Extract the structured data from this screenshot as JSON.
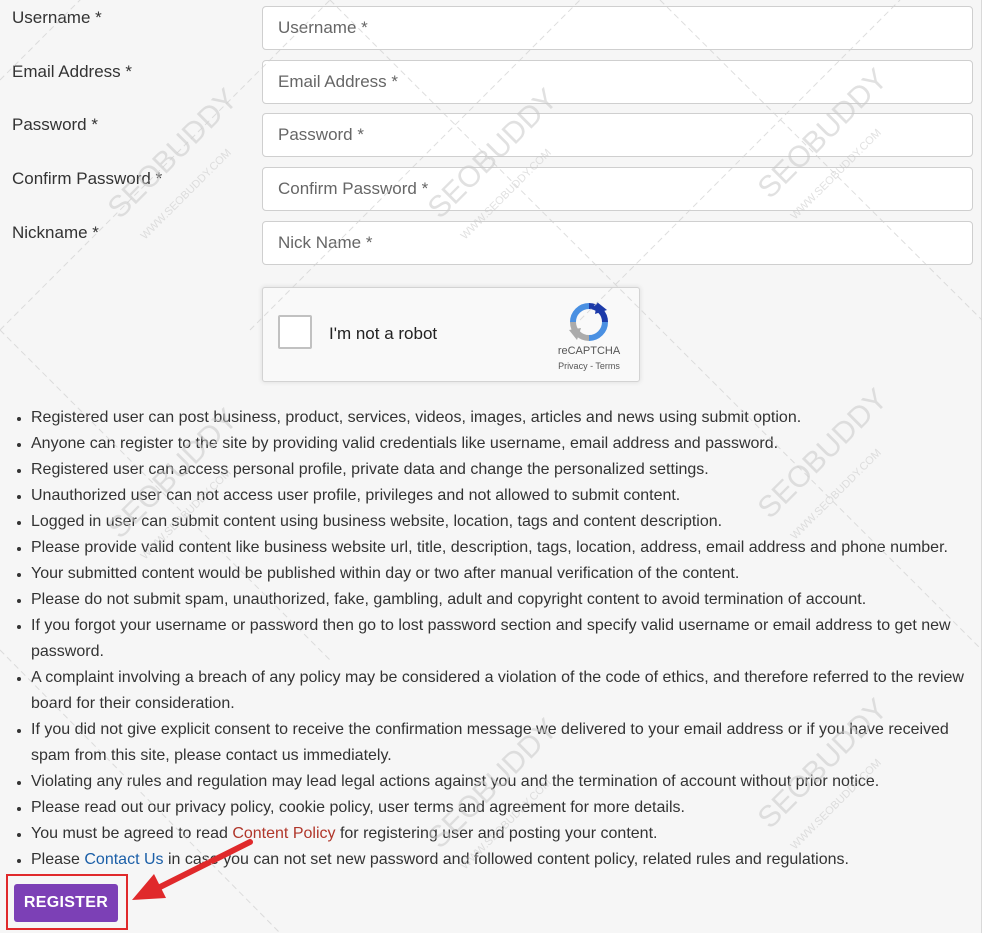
{
  "form": {
    "fields": [
      {
        "label": "Username *",
        "placeholder": "Username *"
      },
      {
        "label": "Email Address *",
        "placeholder": "Email Address *"
      },
      {
        "label": "Password *",
        "placeholder": "Password *"
      },
      {
        "label": "Confirm Password *",
        "placeholder": "Confirm Password *"
      },
      {
        "label": "Nickname *",
        "placeholder": "Nick Name *"
      }
    ]
  },
  "captcha": {
    "label": "I'm not a robot",
    "brand": "reCAPTCHA",
    "privacy": "Privacy",
    "separator": " - ",
    "terms": "Terms",
    "icon": "recaptcha-logo"
  },
  "rules": {
    "items": [
      "Registered user can post business, product, services, videos, images, articles and news using submit option.",
      "Anyone can register to the site by providing valid credentials like username, email address and password.",
      "Registered user can access personal profile, private data and change the personalized settings.",
      "Unauthorized user can not access user profile, privileges and not allowed to submit content.",
      "Logged in user can submit content using business website, location, tags and content description.",
      "Please provide valid content like business website url, title, description, tags, location, address, email address and phone number.",
      "Your submitted content would be published within day or two after manual verification of the content.",
      "Please do not submit spam, unauthorized, fake, gambling, adult and copyright content to avoid termination of account.",
      "If you forgot your username or password then go to lost password section and specify valid username or email address to get new password.",
      "A complaint involving a breach of any policy may be considered a violation of the code of ethics, and therefore referred to the review board for their consideration.",
      "If you did not give explicit consent to receive the confirmation message we delivered to your email address or if you have received spam from this site, please contact us immediately.",
      "Violating any rules and regulation may lead legal actions against you and the termination of account without prior notice.",
      "Please read out our privacy policy, cookie policy, user terms and agreement for more details."
    ],
    "content_policy": {
      "before": "You must be agreed to read ",
      "link": "Content Policy",
      "after": " for registering user and posting your content."
    },
    "contact": {
      "before": "Please ",
      "link": "Contact Us",
      "after": " in case you can not set new password and followed content policy, related rules and regulations."
    }
  },
  "register": {
    "label": "REGISTER"
  },
  "watermark": {
    "brand": "SEOBUDDY",
    "domain": "WWW.SEOBUDDY.COM"
  },
  "colors": {
    "button": "#7c40b6",
    "highlight": "#e0292b",
    "link_red": "#b0362a",
    "link_blue": "#1b5fa8"
  }
}
